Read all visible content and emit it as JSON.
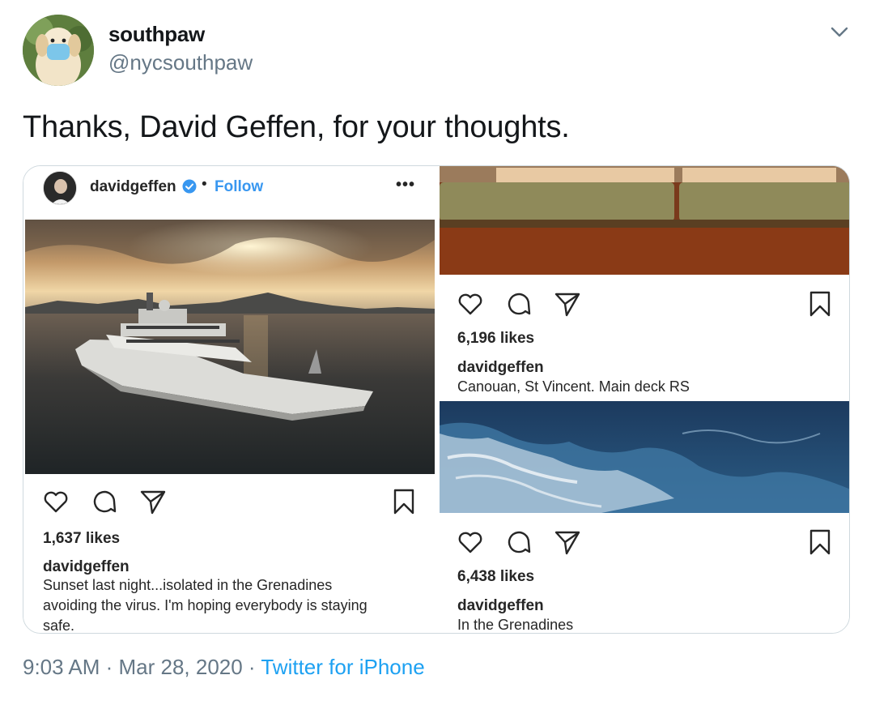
{
  "tweet": {
    "display_name": "southpaw",
    "handle": "@nycsouthpaw",
    "text": "Thanks, David Geffen, for your thoughts.",
    "timestamp": "9:03 AM · Mar 28, 2020 · ",
    "source": "Twitter for iPhone"
  },
  "ig_left": {
    "username": "davidgeffen",
    "separator": "•",
    "follow_label": "Follow",
    "more_label": "•••",
    "likes": "1,637 likes",
    "caption_user": "davidgeffen",
    "caption_lines": [
      "Sunset last night...isolated in the Grenadines",
      "avoiding the virus. I'm hoping everybody is staying",
      "safe."
    ]
  },
  "ig_right_top": {
    "likes": "6,196 likes",
    "caption_user": "davidgeffen",
    "caption": "Canouan, St Vincent. Main deck RS"
  },
  "ig_right_bottom": {
    "likes": "6,438 likes",
    "caption_user": "davidgeffen",
    "caption": "In the Grenadines"
  },
  "icons": [
    "chevron-down-icon",
    "heart-icon",
    "comment-icon",
    "share-icon",
    "bookmark-icon",
    "verified-badge-icon"
  ],
  "colors": {
    "link": "#1da1f2",
    "ig_follow": "#3897f0",
    "muted": "#657786",
    "text": "#14171a"
  }
}
